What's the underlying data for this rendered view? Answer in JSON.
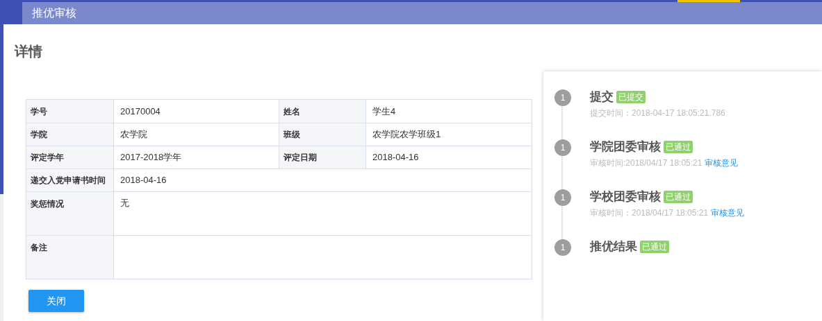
{
  "header": {
    "title": "推优审核"
  },
  "page_title": "详情",
  "details": {
    "rows": [
      {
        "kind": "pair",
        "cells": [
          {
            "label": "学号",
            "value": "20170004"
          },
          {
            "label": "姓名",
            "value": "学生4"
          }
        ]
      },
      {
        "kind": "pair",
        "cells": [
          {
            "label": "学院",
            "value": "农学院"
          },
          {
            "label": "班级",
            "value": "农学院农学班级1"
          }
        ]
      },
      {
        "kind": "pair",
        "cells": [
          {
            "label": "评定学年",
            "value": "2017-2018学年"
          },
          {
            "label": "评定日期",
            "value": "2018-04-16"
          }
        ]
      },
      {
        "kind": "single",
        "cells": [
          {
            "label": "递交入党申请书时间",
            "value": "2018-04-16"
          }
        ]
      },
      {
        "kind": "tall",
        "cells": [
          {
            "label": "奖惩情况",
            "value": "无"
          }
        ]
      },
      {
        "kind": "tall",
        "cells": [
          {
            "label": "备注"
          }
        ]
      }
    ]
  },
  "close_button": "关闭",
  "timeline": [
    {
      "step": "1",
      "title": "提交",
      "status": "已提交",
      "time": "提交时间：2018-04-17 18:05:21.786"
    },
    {
      "step": "1",
      "title": "学院团委审核",
      "status": "已通过",
      "time": "审核时间:2018/04/17 18:05:21",
      "link": "审核意见"
    },
    {
      "step": "1",
      "title": "学校团委审核",
      "status": "已通过",
      "time": "审核时间：2018/04/17 18:05:21",
      "link": "审核意见"
    },
    {
      "step": "1",
      "title": "推优结果",
      "status": "已通过"
    }
  ]
}
